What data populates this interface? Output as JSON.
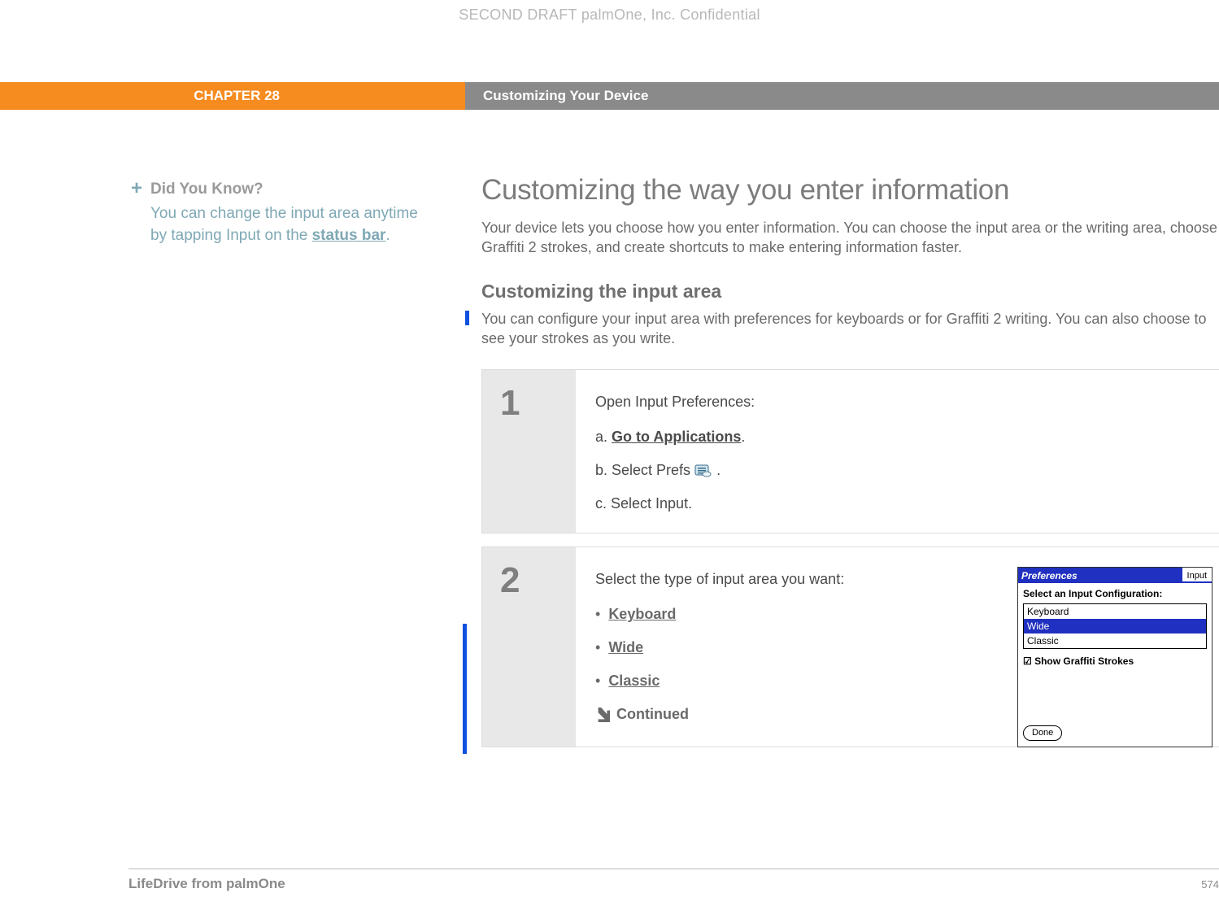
{
  "watermark": "SECOND DRAFT palmOne, Inc.  Confidential",
  "chapter": "CHAPTER 28",
  "chapter_title": "Customizing Your Device",
  "sidebar": {
    "dyk_head": "Did You Know?",
    "dyk_line1": "You can change the input area anytime by tapping Input on the ",
    "dyk_link": "status bar",
    "dyk_tail": "."
  },
  "main": {
    "heading": "Customizing the way you enter information",
    "intro": "Your device lets you choose how you enter information. You can choose the input area or the writing area, choose Graffiti 2 strokes, and create shortcuts to make entering information faster.",
    "subheading": "Customizing the input area",
    "subintro": "You can configure your input area with preferences for keyboards or for Graffiti 2 writing. You can also choose to see your strokes as you write."
  },
  "steps": {
    "s1": {
      "num": "1",
      "lead": "Open Input Preferences:",
      "a_prefix": "a.  ",
      "a_link": "Go to Applications",
      "a_tail": ".",
      "b_prefix": "b.  Select Prefs ",
      "b_tail": ".",
      "c": "c.   Select Input."
    },
    "s2": {
      "num": "2",
      "lead": "Select the type of input area you want:",
      "opt1": "Keyboard",
      "opt2": "Wide",
      "opt3": "Classic",
      "continued": "Continued"
    }
  },
  "screenshot": {
    "title": "Preferences",
    "tab": "Input",
    "label": "Select an Input Configuration:",
    "o1": "Keyboard",
    "o2": "Wide",
    "o3": "Classic",
    "check": "Show Graffiti Strokes",
    "done": "Done"
  },
  "footer": {
    "product": "LifeDrive from palmOne",
    "page": "574"
  }
}
